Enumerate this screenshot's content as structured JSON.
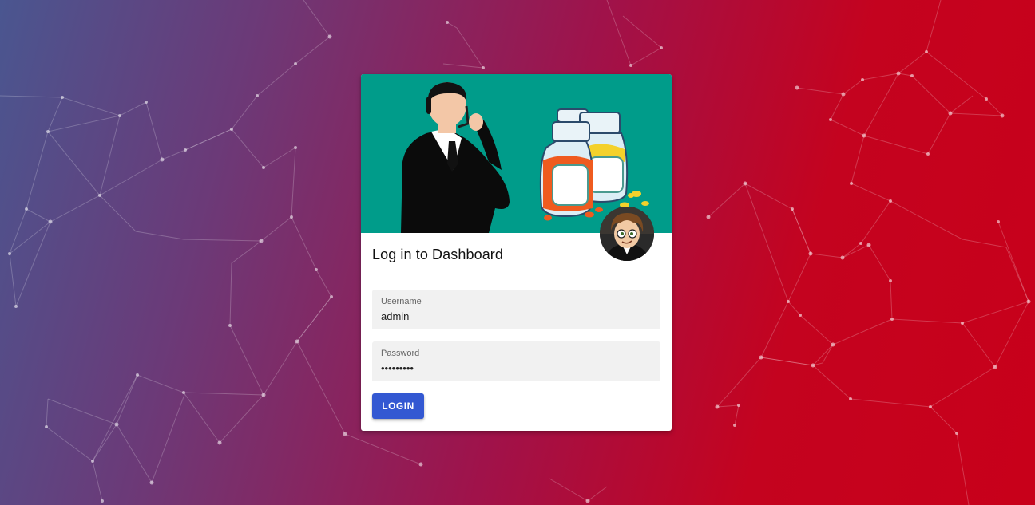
{
  "login": {
    "title": "Log in to Dashboard",
    "username_label": "Username",
    "username_value": "admin",
    "password_label": "Password",
    "password_value": "123456789",
    "submit_label": "LOGIN"
  },
  "colors": {
    "banner": "#009c8a",
    "button": "#3358d2",
    "background_left": "#4a5690",
    "background_right": "#c8001a"
  },
  "icons": [
    "network-background",
    "businessman-illustration",
    "pill-bottles-illustration",
    "user-avatar-icon"
  ]
}
